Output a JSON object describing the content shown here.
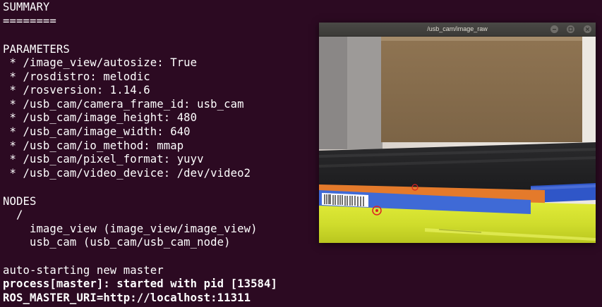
{
  "terminal": {
    "lines": [
      "SUMMARY",
      "========",
      "",
      "PARAMETERS",
      " * /image_view/autosize: True",
      " * /rosdistro: melodic",
      " * /rosversion: 1.14.6",
      " * /usb_cam/camera_frame_id: usb_cam",
      " * /usb_cam/image_height: 480",
      " * /usb_cam/image_width: 640",
      " * /usb_cam/io_method: mmap",
      " * /usb_cam/pixel_format: yuyv",
      " * /usb_cam/video_device: /dev/video2",
      "",
      "NODES",
      "  /",
      "    image_view (image_view/image_view)",
      "    usb_cam (usb_cam/usb_cam_node)",
      "",
      "auto-starting new master",
      "process[master]: started with pid [13584]",
      "ROS_MASTER_URI=http://localhost:11311"
    ]
  },
  "image_window": {
    "title": "/usb_cam/image_raw",
    "buttons": [
      "minimize-icon",
      "maximize-icon",
      "close-icon"
    ],
    "image_text": {
      "barcode_digits": "4006381131",
      "label_line1": "EAN 4006381131",
      "label_line2": "ART.NO. 3553/1"
    }
  },
  "colors": {
    "terminal_bg": "#2c0a22",
    "terminal_fg": "#ffffff",
    "titlebar_bg": "#3e3d39"
  }
}
